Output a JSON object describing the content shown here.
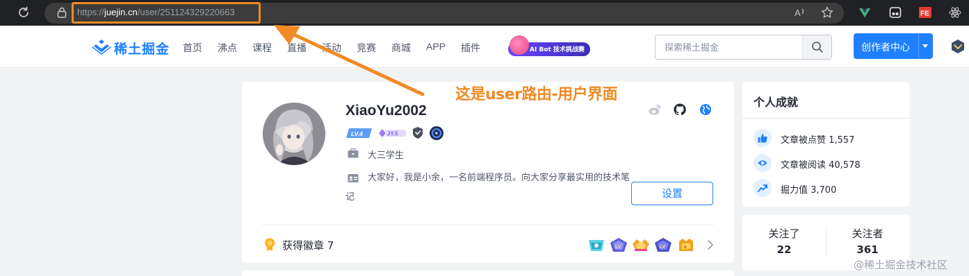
{
  "browser": {
    "url_protocol": "https://",
    "url_host": "juejin.cn",
    "url_path": "/user/251124329220663"
  },
  "header": {
    "logo_text": "稀土掘金",
    "nav": [
      "首页",
      "沸点",
      "课程",
      "直播",
      "活动",
      "竞赛",
      "商城",
      "APP",
      "插件"
    ],
    "ai_bot_label": "AI Bot 技术挑战赛",
    "search_placeholder": "探索稀土掘金",
    "creator_label": "创作者中心"
  },
  "annotation": {
    "text": "这是user路由-用户界面",
    "color": "#f08a24"
  },
  "profile": {
    "username": "XiaoYu2002",
    "level_badge": "LV.4",
    "jy_badge": "JY.5",
    "job": "大三学生",
    "bio": "大家好，我是小余，一名前端程序员。向大家分享最实用的技术笔记",
    "settings_label": "设置",
    "badges_label": "获得徽章 7"
  },
  "achievements": {
    "title": "个人成就",
    "items": [
      {
        "label": "文章被点赞 1,557",
        "icon": "thumbs-up-icon"
      },
      {
        "label": "文章被阅读 40,578",
        "icon": "eye-icon"
      },
      {
        "label": "掘力值 3,700",
        "icon": "trend-up-icon"
      }
    ]
  },
  "follow": {
    "following_label": "关注了",
    "following_count": "22",
    "followers_label": "关注者",
    "followers_count": "361"
  },
  "watermark": "@稀土掘金技术社区",
  "colors": {
    "brand": "#1e80ff",
    "annotation": "#f08a24",
    "browser_bg": "#202124"
  }
}
